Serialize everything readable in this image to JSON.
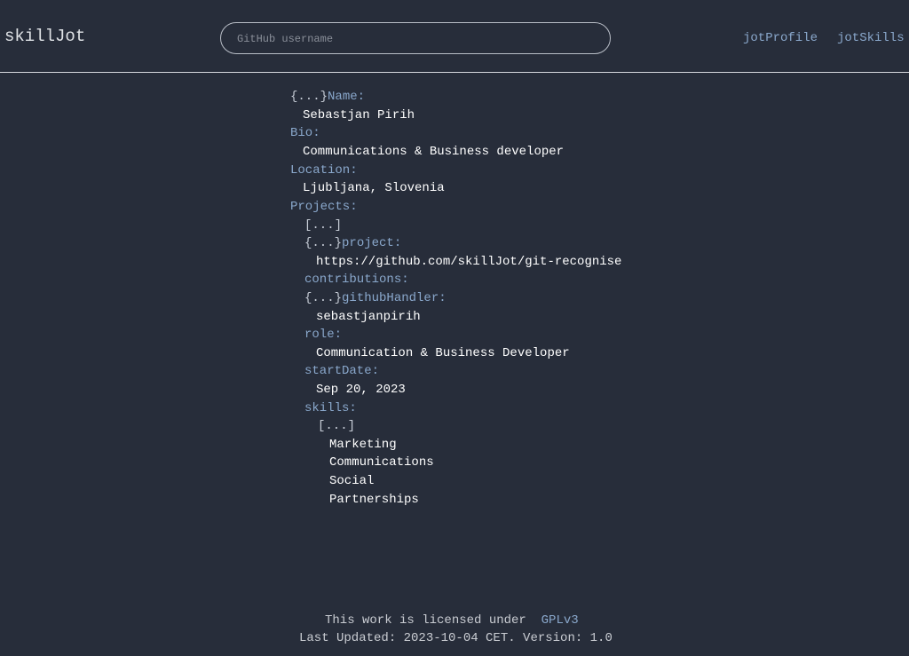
{
  "header": {
    "brand": "skillJot",
    "search_placeholder": "GitHub username",
    "nav": {
      "profile": "jotProfile",
      "skills": "jotSkills"
    }
  },
  "profile": {
    "collapse_marker": "{...}",
    "array_marker": "[...]",
    "name_key": "Name:",
    "name": "Sebastjan Pirih",
    "bio_key": "Bio:",
    "bio": "Communications & Business developer",
    "location_key": "Location:",
    "location": "Ljubljana, Slovenia",
    "projects_key": "Projects:",
    "project_key": "project:",
    "project_url": "https://github.com/skillJot/git-recognise",
    "contributions_key": "contributions:",
    "github_handler_key": "githubHandler:",
    "github_handler": "sebastjanpirih",
    "role_key": "role:",
    "role": "Communication & Business Developer",
    "start_date_key": "startDate:",
    "start_date": "Sep 20, 2023",
    "skills_key": "skills:",
    "skills": [
      "Marketing",
      "Communications",
      "Social",
      "Partnerships"
    ]
  },
  "footer": {
    "license_text": "This work is licensed under",
    "license_link": "GPLv3",
    "updated_text": "Last Updated: 2023-10-04 CET. Version: 1.0"
  },
  "colors": {
    "background": "#272d3a",
    "key": "#8aa8cc",
    "value": "#ffffff"
  }
}
